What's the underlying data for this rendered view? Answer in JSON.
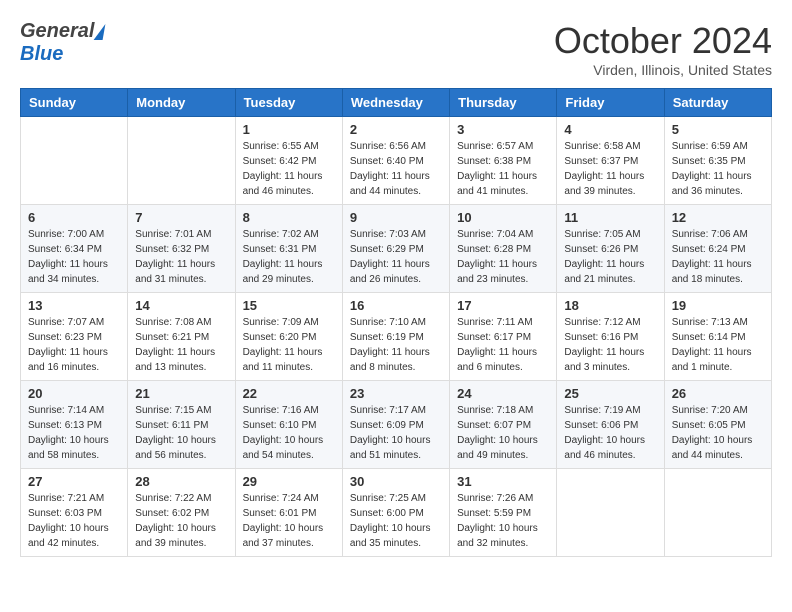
{
  "header": {
    "logo_general": "General",
    "logo_blue": "Blue",
    "month_year": "October 2024",
    "location": "Virden, Illinois, United States"
  },
  "weekdays": [
    "Sunday",
    "Monday",
    "Tuesday",
    "Wednesday",
    "Thursday",
    "Friday",
    "Saturday"
  ],
  "weeks": [
    [
      {
        "day": "",
        "detail": ""
      },
      {
        "day": "",
        "detail": ""
      },
      {
        "day": "1",
        "detail": "Sunrise: 6:55 AM\nSunset: 6:42 PM\nDaylight: 11 hours and 46 minutes."
      },
      {
        "day": "2",
        "detail": "Sunrise: 6:56 AM\nSunset: 6:40 PM\nDaylight: 11 hours and 44 minutes."
      },
      {
        "day": "3",
        "detail": "Sunrise: 6:57 AM\nSunset: 6:38 PM\nDaylight: 11 hours and 41 minutes."
      },
      {
        "day": "4",
        "detail": "Sunrise: 6:58 AM\nSunset: 6:37 PM\nDaylight: 11 hours and 39 minutes."
      },
      {
        "day": "5",
        "detail": "Sunrise: 6:59 AM\nSunset: 6:35 PM\nDaylight: 11 hours and 36 minutes."
      }
    ],
    [
      {
        "day": "6",
        "detail": "Sunrise: 7:00 AM\nSunset: 6:34 PM\nDaylight: 11 hours and 34 minutes."
      },
      {
        "day": "7",
        "detail": "Sunrise: 7:01 AM\nSunset: 6:32 PM\nDaylight: 11 hours and 31 minutes."
      },
      {
        "day": "8",
        "detail": "Sunrise: 7:02 AM\nSunset: 6:31 PM\nDaylight: 11 hours and 29 minutes."
      },
      {
        "day": "9",
        "detail": "Sunrise: 7:03 AM\nSunset: 6:29 PM\nDaylight: 11 hours and 26 minutes."
      },
      {
        "day": "10",
        "detail": "Sunrise: 7:04 AM\nSunset: 6:28 PM\nDaylight: 11 hours and 23 minutes."
      },
      {
        "day": "11",
        "detail": "Sunrise: 7:05 AM\nSunset: 6:26 PM\nDaylight: 11 hours and 21 minutes."
      },
      {
        "day": "12",
        "detail": "Sunrise: 7:06 AM\nSunset: 6:24 PM\nDaylight: 11 hours and 18 minutes."
      }
    ],
    [
      {
        "day": "13",
        "detail": "Sunrise: 7:07 AM\nSunset: 6:23 PM\nDaylight: 11 hours and 16 minutes."
      },
      {
        "day": "14",
        "detail": "Sunrise: 7:08 AM\nSunset: 6:21 PM\nDaylight: 11 hours and 13 minutes."
      },
      {
        "day": "15",
        "detail": "Sunrise: 7:09 AM\nSunset: 6:20 PM\nDaylight: 11 hours and 11 minutes."
      },
      {
        "day": "16",
        "detail": "Sunrise: 7:10 AM\nSunset: 6:19 PM\nDaylight: 11 hours and 8 minutes."
      },
      {
        "day": "17",
        "detail": "Sunrise: 7:11 AM\nSunset: 6:17 PM\nDaylight: 11 hours and 6 minutes."
      },
      {
        "day": "18",
        "detail": "Sunrise: 7:12 AM\nSunset: 6:16 PM\nDaylight: 11 hours and 3 minutes."
      },
      {
        "day": "19",
        "detail": "Sunrise: 7:13 AM\nSunset: 6:14 PM\nDaylight: 11 hours and 1 minute."
      }
    ],
    [
      {
        "day": "20",
        "detail": "Sunrise: 7:14 AM\nSunset: 6:13 PM\nDaylight: 10 hours and 58 minutes."
      },
      {
        "day": "21",
        "detail": "Sunrise: 7:15 AM\nSunset: 6:11 PM\nDaylight: 10 hours and 56 minutes."
      },
      {
        "day": "22",
        "detail": "Sunrise: 7:16 AM\nSunset: 6:10 PM\nDaylight: 10 hours and 54 minutes."
      },
      {
        "day": "23",
        "detail": "Sunrise: 7:17 AM\nSunset: 6:09 PM\nDaylight: 10 hours and 51 minutes."
      },
      {
        "day": "24",
        "detail": "Sunrise: 7:18 AM\nSunset: 6:07 PM\nDaylight: 10 hours and 49 minutes."
      },
      {
        "day": "25",
        "detail": "Sunrise: 7:19 AM\nSunset: 6:06 PM\nDaylight: 10 hours and 46 minutes."
      },
      {
        "day": "26",
        "detail": "Sunrise: 7:20 AM\nSunset: 6:05 PM\nDaylight: 10 hours and 44 minutes."
      }
    ],
    [
      {
        "day": "27",
        "detail": "Sunrise: 7:21 AM\nSunset: 6:03 PM\nDaylight: 10 hours and 42 minutes."
      },
      {
        "day": "28",
        "detail": "Sunrise: 7:22 AM\nSunset: 6:02 PM\nDaylight: 10 hours and 39 minutes."
      },
      {
        "day": "29",
        "detail": "Sunrise: 7:24 AM\nSunset: 6:01 PM\nDaylight: 10 hours and 37 minutes."
      },
      {
        "day": "30",
        "detail": "Sunrise: 7:25 AM\nSunset: 6:00 PM\nDaylight: 10 hours and 35 minutes."
      },
      {
        "day": "31",
        "detail": "Sunrise: 7:26 AM\nSunset: 5:59 PM\nDaylight: 10 hours and 32 minutes."
      },
      {
        "day": "",
        "detail": ""
      },
      {
        "day": "",
        "detail": ""
      }
    ]
  ]
}
